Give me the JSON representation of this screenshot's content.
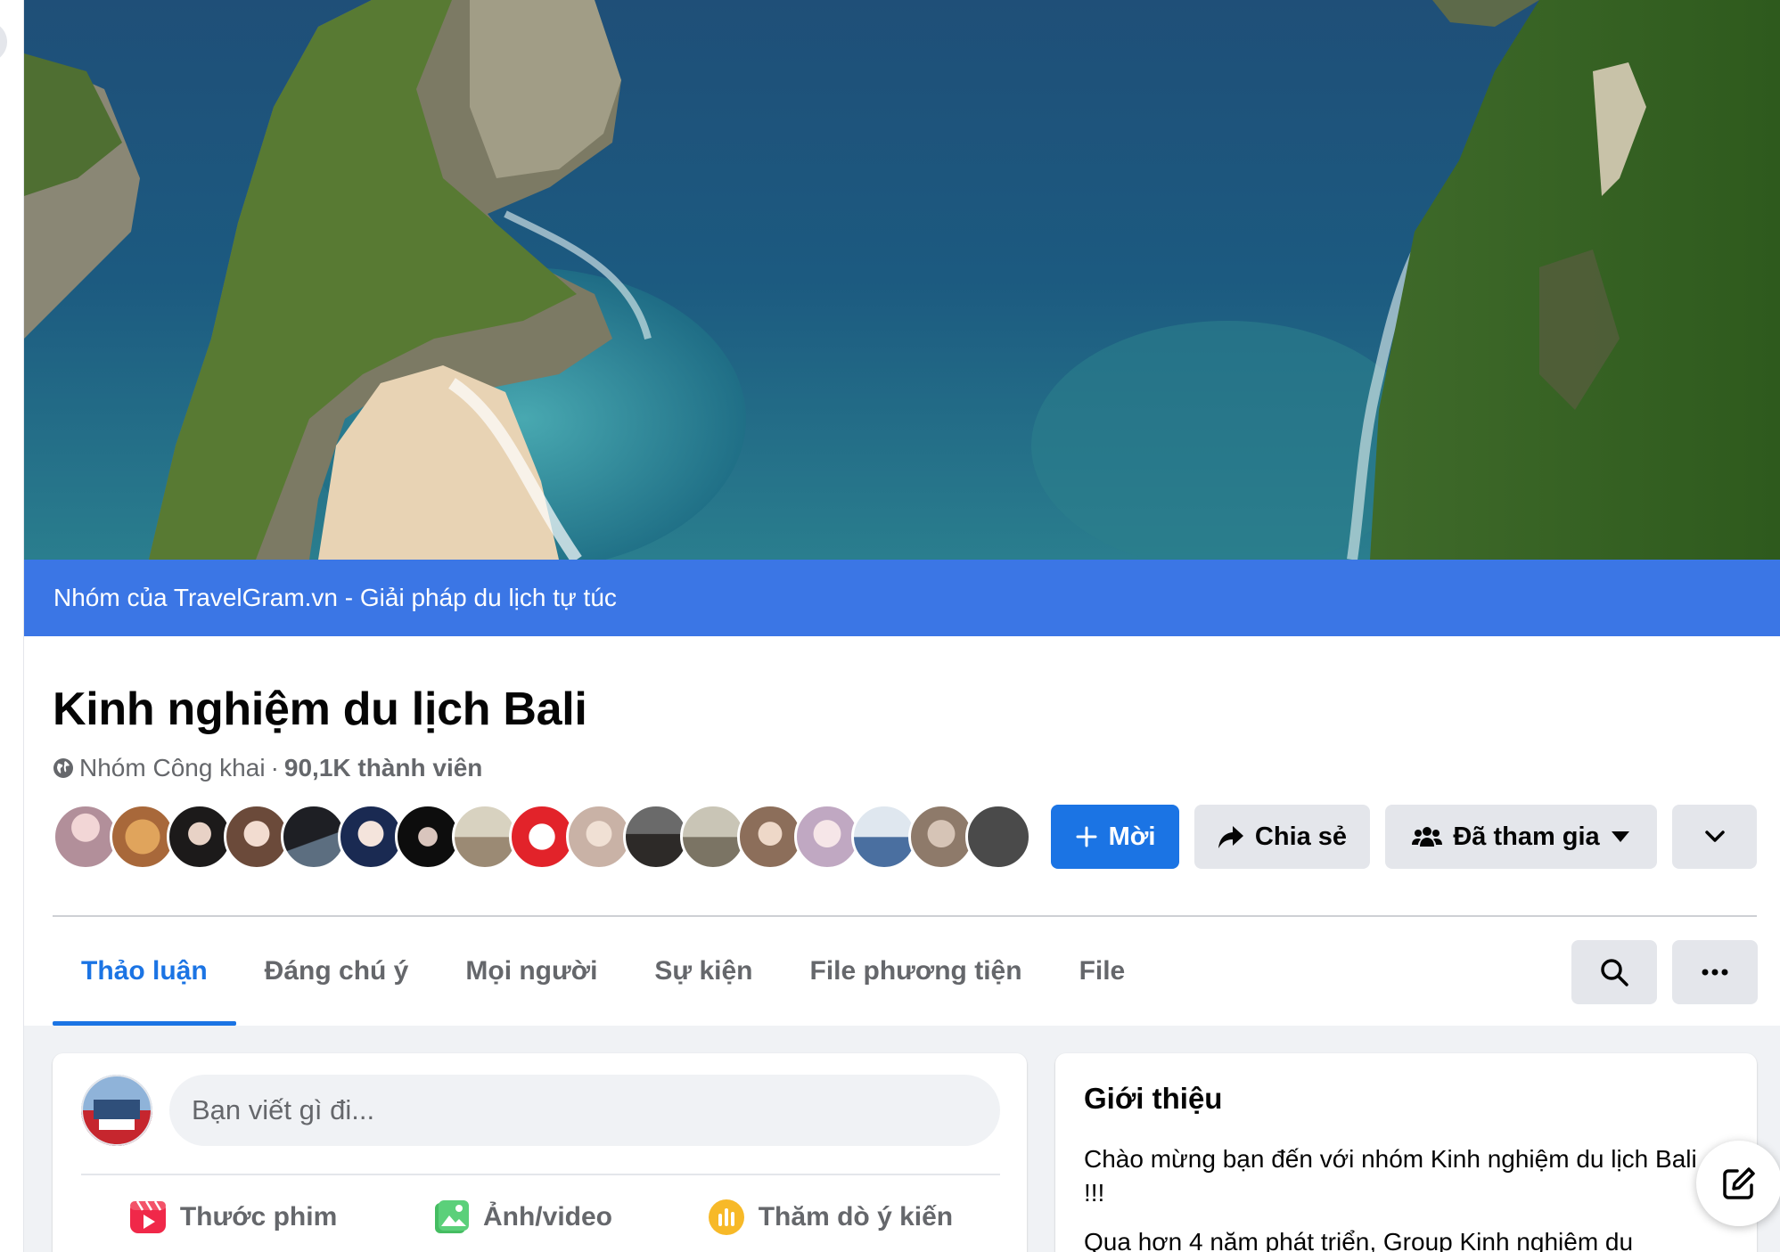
{
  "cover": {
    "owner_bar_text": "Nhóm của TravelGram.vn - Giải pháp du lịch tự túc"
  },
  "group": {
    "title": "Kinh nghiệm du lịch Bali",
    "privacy": "Nhóm Công khai",
    "separator": "·",
    "members": "90,1K thành viên",
    "member_avatar_count": 17
  },
  "actions": {
    "invite_label": "Mời",
    "share_label": "Chia sẻ",
    "joined_label": "Đã tham gia"
  },
  "tabs": [
    {
      "label": "Thảo luận",
      "active": true
    },
    {
      "label": "Đáng chú ý",
      "active": false
    },
    {
      "label": "Mọi người",
      "active": false
    },
    {
      "label": "Sự kiện",
      "active": false
    },
    {
      "label": "File phương tiện",
      "active": false
    },
    {
      "label": "File",
      "active": false
    }
  ],
  "composer": {
    "placeholder": "Bạn viết gì đi...",
    "reel_label": "Thước phim",
    "photo_label": "Ảnh/video",
    "poll_label": "Thăm dò ý kiến"
  },
  "about": {
    "heading": "Giới thiệu",
    "line1": "Chào mừng bạn đến với nhóm Kinh nghiệm du lịch Bali !!!",
    "line2": "Qua hơn 4 năm phát triển, Group Kinh nghiệm du"
  },
  "colors": {
    "accent": "#1b74e4",
    "owner_bar": "#3b76e5",
    "background": "#f0f2f5"
  },
  "icons": {
    "privacy": "globe-icon",
    "invite": "plus-icon",
    "share": "share-arrow-icon",
    "joined": "group-people-icon",
    "joined_caret": "caret-down-icon",
    "more": "chevron-down-icon",
    "search": "search-icon",
    "menu": "more-dots-icon",
    "reel": "reel-icon",
    "photo": "photo-icon",
    "poll": "poll-icon",
    "new_message": "compose-icon"
  }
}
